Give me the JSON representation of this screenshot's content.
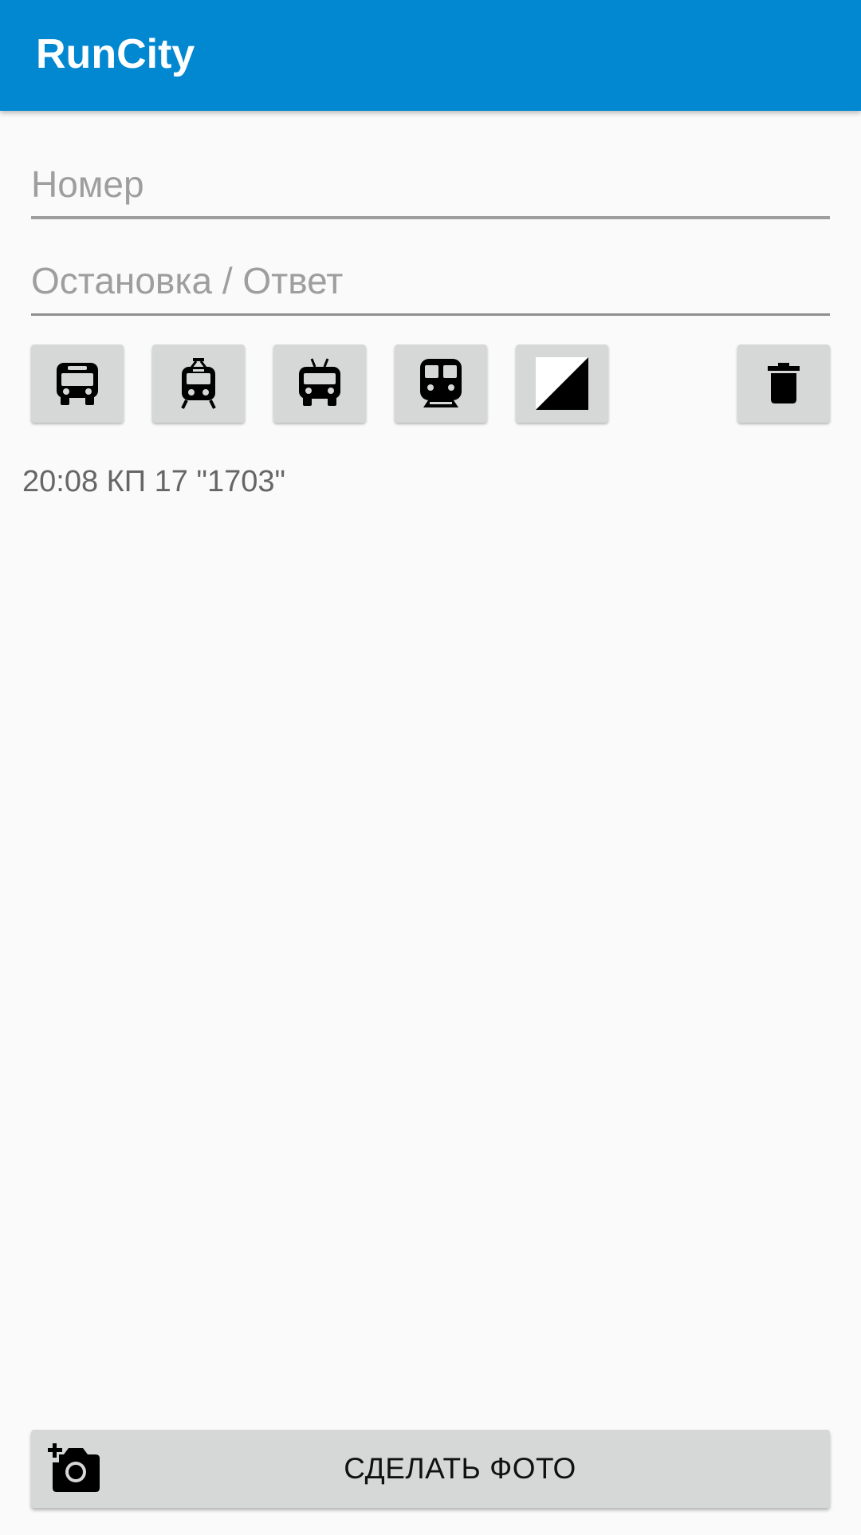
{
  "app_bar": {
    "title": "RunCity",
    "color": "#0288d1"
  },
  "form": {
    "number_placeholder": "Номер",
    "number_value": "",
    "stop_placeholder": "Остановка / Ответ",
    "stop_value": ""
  },
  "transport_buttons": [
    {
      "icon": "bus-icon"
    },
    {
      "icon": "tram-icon"
    },
    {
      "icon": "trolleybus-icon"
    },
    {
      "icon": "subway-icon"
    },
    {
      "icon": "half-square-icon"
    }
  ],
  "delete_button": {
    "icon": "trash-icon"
  },
  "log": {
    "entries": [
      "20:08 КП 17 \"1703\""
    ]
  },
  "photo_button": {
    "label": "СДЕЛАТЬ ФОТО",
    "icon": "add-camera-icon"
  }
}
